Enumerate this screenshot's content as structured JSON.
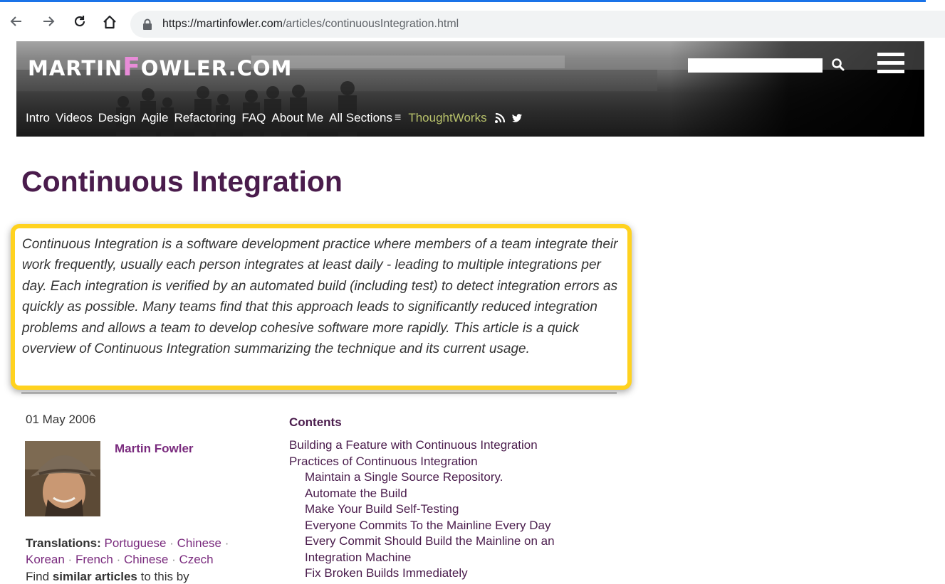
{
  "browser": {
    "url_host": "https://martinfowler.com",
    "url_path": "/articles/continuousIntegration.html",
    "nav_back_icon": "back-arrow-icon",
    "nav_forward_icon": "forward-arrow-icon",
    "reload_icon": "reload-icon",
    "home_icon": "home-icon",
    "accent_color": "#1a73e8"
  },
  "header": {
    "logo_part1": "MARTIN",
    "logo_accent": "F",
    "logo_part2": "OWLER.COM",
    "nav": {
      "intro": "Intro",
      "videos": "Videos",
      "design": "Design",
      "agile": "Agile",
      "refactoring": "Refactoring",
      "faq": "FAQ",
      "about": "About Me",
      "all_sections": "All Sections",
      "thoughtworks": "ThoughtWorks"
    },
    "logo_accent_color": "#e88cd8",
    "thoughtworks_color": "#b8c26b"
  },
  "article": {
    "title": "Continuous Integration",
    "abstract": "Continuous Integration is a software development practice where members of a team integrate their work frequently, usually each person integrates at least daily - leading to multiple integrations per day. Each integration is verified by an automated build (including test) to detect integration errors as quickly as possible. Many teams find that this approach leads to significantly reduced integration problems and allows a team to develop cohesive software more rapidly. This article is a quick overview of Continuous Integration summarizing the technique and its current usage.",
    "date": "01 May 2006",
    "author": "Martin Fowler",
    "translations_label": "Translations:",
    "translations": [
      "Portuguese",
      "Chinese",
      "Korean",
      "French",
      "Chinese",
      "Czech"
    ],
    "similar_prefix": "Find",
    "similar_strong": "similar articles",
    "similar_suffix": "to this by",
    "highlight_color": "#ffd21f",
    "title_color": "#4a1c4c"
  },
  "toc": {
    "heading": "Contents",
    "items": [
      "Building a Feature with Continuous Integration",
      "Practices of Continuous Integration",
      "Maintain a Single Source Repository.",
      "Automate the Build",
      "Make Your Build Self-Testing",
      "Everyone Commits To the Mainline Every Day",
      "Every Commit Should Build the Mainline on an",
      "Integration Machine",
      "Fix Broken Builds Immediately"
    ]
  }
}
